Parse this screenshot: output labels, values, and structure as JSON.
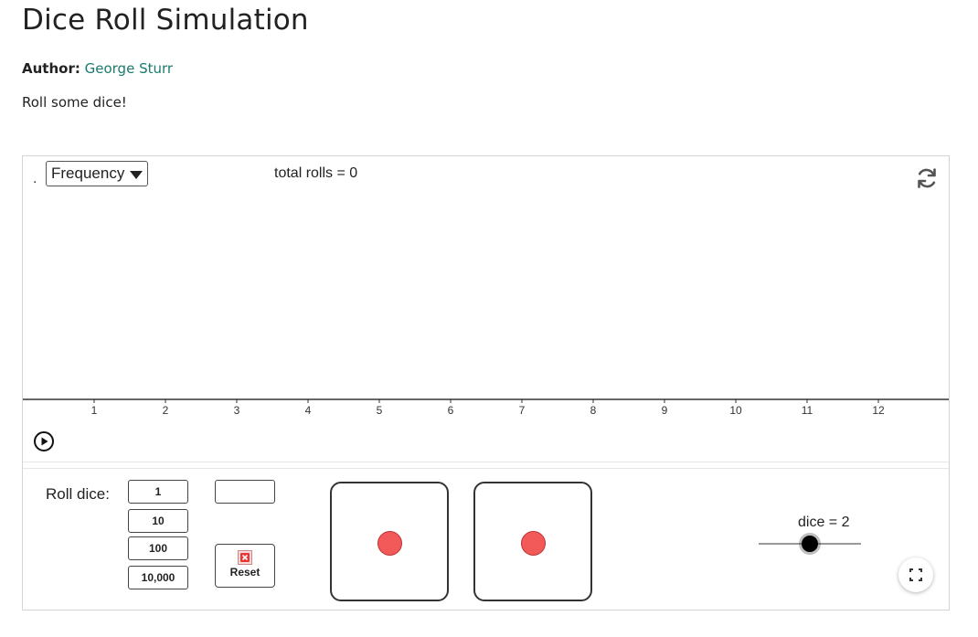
{
  "page": {
    "title": "Dice Roll Simulation",
    "author_label": "Author:",
    "author_name": "George Sturr",
    "description": "Roll some dice!"
  },
  "applet": {
    "dot": ".",
    "mode_select": {
      "value": "Frequency"
    },
    "total_rolls_text": "total rolls = 0",
    "axis": {
      "ticks": [
        "1",
        "2",
        "3",
        "4",
        "5",
        "6",
        "7",
        "8",
        "9",
        "10",
        "11",
        "12"
      ]
    },
    "controls": {
      "roll_label": "Roll dice:",
      "roll_buttons": [
        "1",
        "10",
        "100",
        "10,000"
      ],
      "custom_input_value": "",
      "reset_label": "Reset"
    },
    "dice": [
      {
        "face": 1
      },
      {
        "face": 1
      }
    ],
    "slider": {
      "label": "dice = 2",
      "value": 2
    },
    "icons": {
      "refresh": "refresh-icon",
      "play": "play-icon",
      "reset": "reset-icon",
      "fullscreen": "fullscreen-icon"
    },
    "colors": {
      "pip": "#f25a5a",
      "author_link": "#1a7a6e"
    }
  }
}
